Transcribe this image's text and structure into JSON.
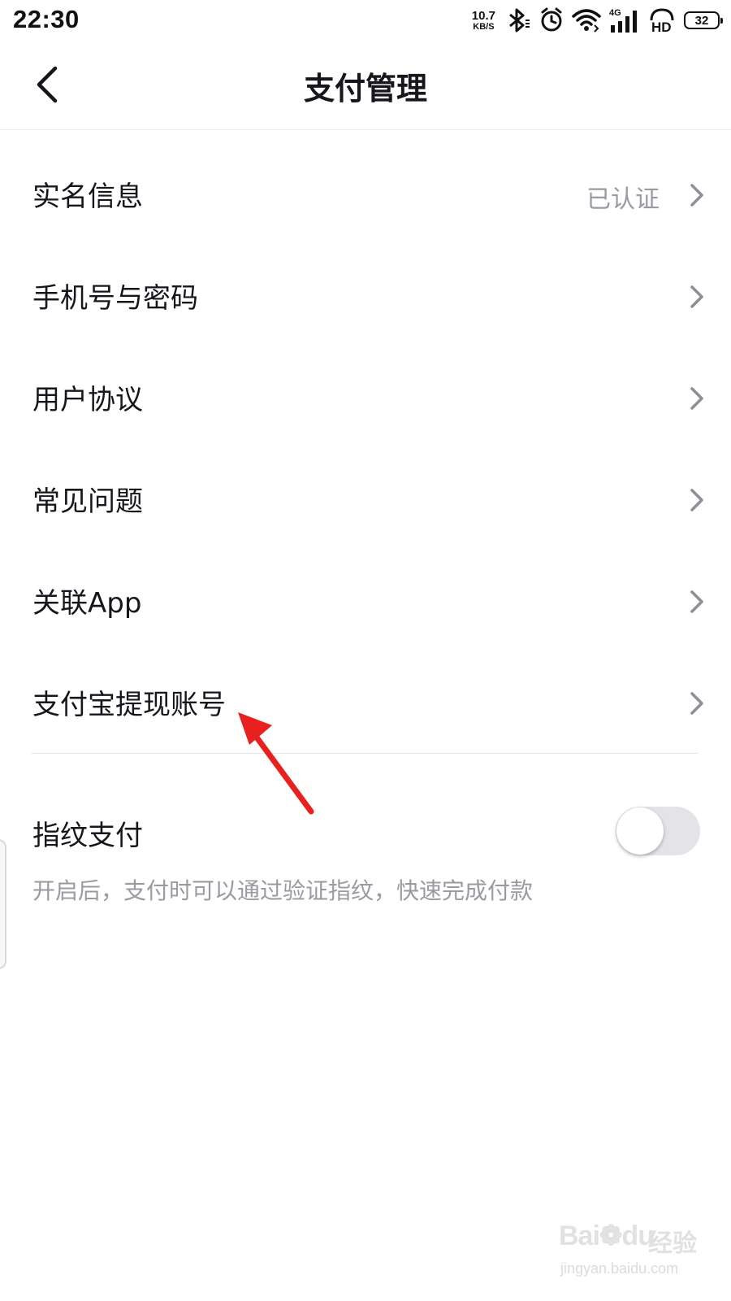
{
  "status_bar": {
    "time": "22:30",
    "net_speed_value": "10.7",
    "net_speed_unit": "KB/S",
    "network_type": "4G",
    "hd_label": "HD",
    "battery_level": "32",
    "icons": [
      "bluetooth-icon",
      "alarm-icon",
      "wifi-icon",
      "signal-icon",
      "hd-voice-icon",
      "battery-icon"
    ]
  },
  "nav": {
    "title": "支付管理",
    "back_icon": "back-chevron-icon"
  },
  "menu": {
    "items": [
      {
        "label": "实名信息",
        "value": "已认证"
      },
      {
        "label": "手机号与密码",
        "value": ""
      },
      {
        "label": "用户协议",
        "value": ""
      },
      {
        "label": "常见问题",
        "value": ""
      },
      {
        "label": "关联App",
        "value": ""
      },
      {
        "label": "支付宝提现账号",
        "value": ""
      }
    ]
  },
  "fingerprint": {
    "label": "指纹支付",
    "description": "开启后，支付时可以通过验证指纹，快速完成付款",
    "enabled": false
  },
  "annotation": {
    "type": "arrow",
    "color": "#e8211f",
    "points_to": "支付宝提现账号"
  },
  "watermark": {
    "brand": "Bai",
    "brand_suffix": "du",
    "brand_cn": "经验",
    "url": "jingyan.baidu.com"
  },
  "colors": {
    "text_primary": "#16161d",
    "text_secondary": "#9a9aa2",
    "divider": "#ececef",
    "toggle_off": "#e4e3e8"
  }
}
